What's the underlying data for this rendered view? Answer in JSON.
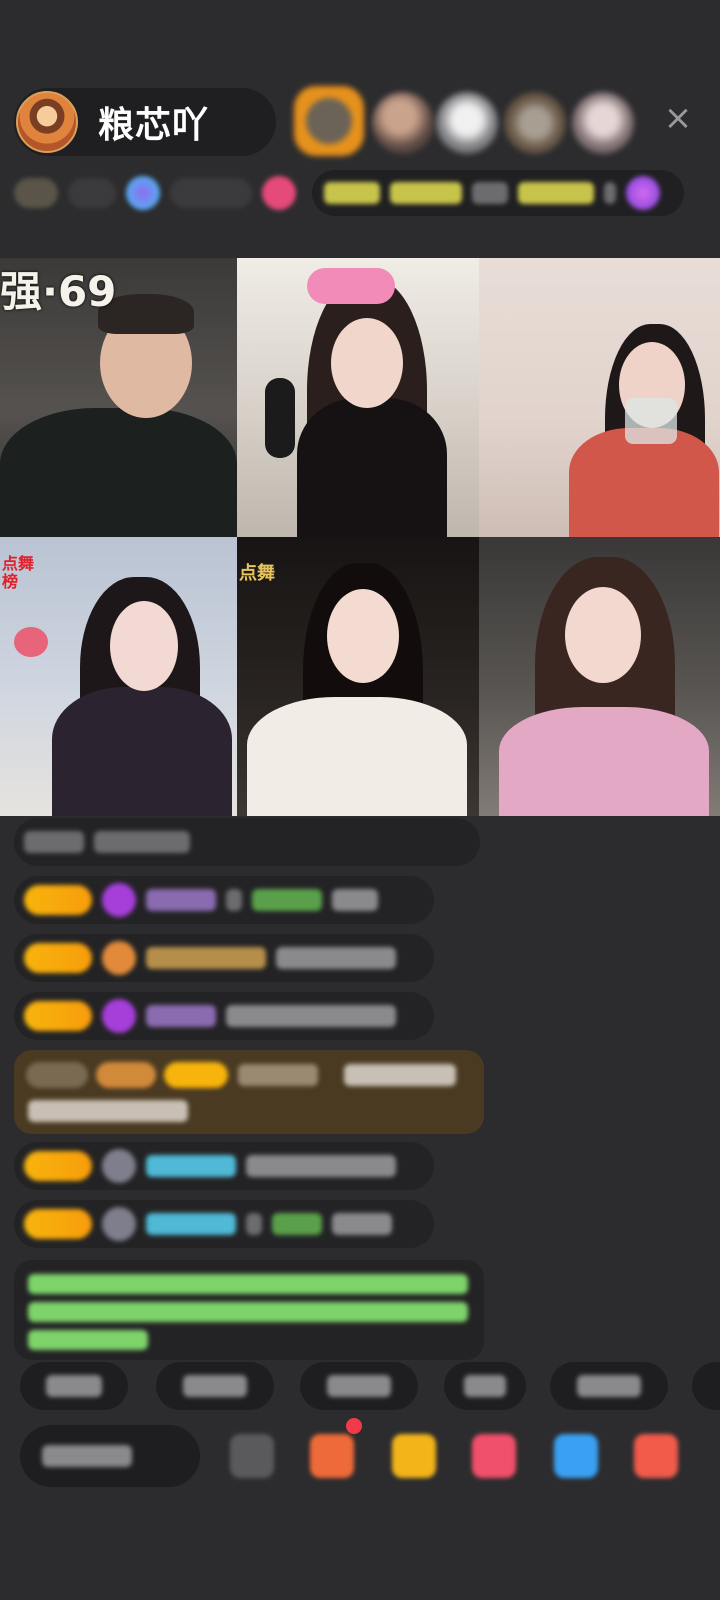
{
  "host": {
    "name": "粮芯吖",
    "avatar_icon": "host-avatar-icon"
  },
  "viewers": [
    "viewer-avatar-1",
    "viewer-avatar-2",
    "viewer-avatar-3",
    "viewer-avatar-4",
    "viewer-avatar-5"
  ],
  "close_icon": "×",
  "video_tiles": [
    {
      "overlay": "强·69"
    },
    {
      "overlay": ""
    },
    {
      "overlay": ""
    },
    {
      "overlay": "点舞\n榜"
    },
    {
      "overlay": "点舞"
    },
    {
      "overlay": ""
    }
  ],
  "colors": {
    "background": "#2c2c2e",
    "panel": "#232325",
    "level_badge": "#f7b40c",
    "gift_message_bg": "#4a3a22",
    "system_text": "#7fd36b",
    "username_cyan": "#4fb9d6"
  }
}
